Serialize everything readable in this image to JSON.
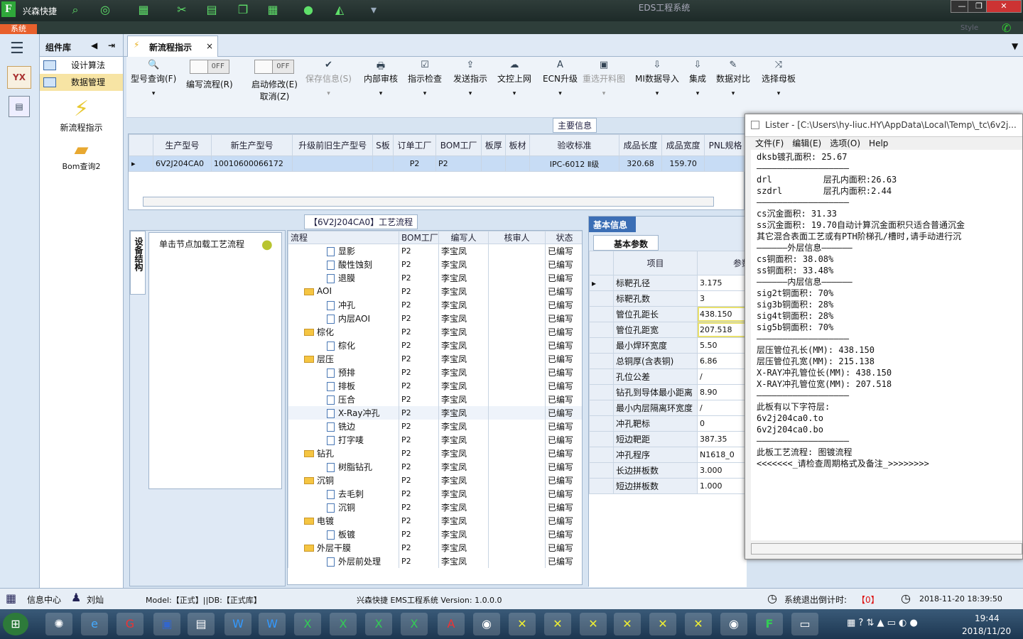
{
  "app": {
    "name": "兴森快捷",
    "window_title": "EDS工程系统",
    "menu_system": "系统",
    "style_label": "Style"
  },
  "rail": {
    "logo": "YX"
  },
  "left_panel": {
    "header": "组件库",
    "items": [
      {
        "label": "设计算法"
      },
      {
        "label": "数据管理"
      }
    ],
    "big_items": [
      {
        "label": "新流程指示"
      },
      {
        "label": "Bom查询2"
      }
    ]
  },
  "tab": {
    "label": "新流程指示"
  },
  "toolbar": {
    "buttons": [
      {
        "label": "型号查询(F)",
        "icon": "🔍"
      },
      {
        "label": "编写流程(R)",
        "toggle": "OFF"
      },
      {
        "label": "启动修改(E)",
        "label2": "取消(Z)",
        "toggle": "OFF"
      },
      {
        "label": "保存信息(S)",
        "icon": "✔"
      },
      {
        "label": "内部审核",
        "icon": "🖶"
      },
      {
        "label": "指示检查",
        "icon": "☑"
      },
      {
        "label": "发送指示",
        "icon": "⇪"
      },
      {
        "label": "文控上网",
        "icon": "☁"
      },
      {
        "label": "ECN升级",
        "icon": "A"
      },
      {
        "label": "重选开料图",
        "icon": "▣"
      },
      {
        "label": "MI数据导入",
        "icon": "⇩"
      },
      {
        "label": "集成",
        "icon": "⇩"
      },
      {
        "label": "数据对比",
        "icon": "✎"
      },
      {
        "label": "选择母板",
        "icon": "⤨"
      }
    ]
  },
  "main_info": {
    "title": "主要信息",
    "columns": [
      "生产型号",
      "新生产型号",
      "升级前旧生产型号",
      "S板",
      "订单工厂",
      "BOM工厂",
      "板厚",
      "板材",
      "验收标准",
      "成品长度",
      "成品宽度",
      "PNL规格"
    ],
    "row": [
      "6V2J204CA0",
      "10010600066172",
      "",
      "",
      "P2",
      "P2",
      "",
      "",
      "IPC-6012 Ⅱ级",
      "320.68",
      "159.70",
      ""
    ]
  },
  "process": {
    "title": "【6V2J204CA0】工艺流程",
    "side_tab": "设备结构",
    "node_hint": "单击节点加载工艺流程",
    "columns": [
      "流程",
      "BOM工厂",
      "编写人",
      "核审人",
      "状态"
    ],
    "rows": [
      {
        "name": "显影",
        "level": 2,
        "folder": false,
        "bom": "P2",
        "writer": "李宝凤",
        "status": "已编写"
      },
      {
        "name": "酸性蚀刻",
        "level": 2,
        "folder": false,
        "bom": "P2",
        "writer": "李宝凤",
        "status": "已编写"
      },
      {
        "name": "退膜",
        "level": 2,
        "folder": false,
        "bom": "P2",
        "writer": "李宝凤",
        "status": "已编写"
      },
      {
        "name": "AOI",
        "level": 1,
        "folder": true,
        "bom": "P2",
        "writer": "李宝凤",
        "status": "已编写"
      },
      {
        "name": "冲孔",
        "level": 2,
        "folder": false,
        "bom": "P2",
        "writer": "李宝凤",
        "status": "已编写"
      },
      {
        "name": "内层AOI",
        "level": 2,
        "folder": false,
        "bom": "P2",
        "writer": "李宝凤",
        "status": "已编写"
      },
      {
        "name": "棕化",
        "level": 1,
        "folder": true,
        "bom": "P2",
        "writer": "李宝凤",
        "status": "已编写"
      },
      {
        "name": "棕化",
        "level": 2,
        "folder": false,
        "bom": "P2",
        "writer": "李宝凤",
        "status": "已编写"
      },
      {
        "name": "层压",
        "level": 1,
        "folder": true,
        "bom": "P2",
        "writer": "李宝凤",
        "status": "已编写"
      },
      {
        "name": "预排",
        "level": 2,
        "folder": false,
        "bom": "P2",
        "writer": "李宝凤",
        "status": "已编写"
      },
      {
        "name": "排板",
        "level": 2,
        "folder": false,
        "bom": "P2",
        "writer": "李宝凤",
        "status": "已编写"
      },
      {
        "name": "压合",
        "level": 2,
        "folder": false,
        "bom": "P2",
        "writer": "李宝凤",
        "status": "已编写"
      },
      {
        "name": "X-Ray冲孔",
        "level": 2,
        "folder": false,
        "bom": "P2",
        "writer": "李宝凤",
        "status": "已编写"
      },
      {
        "name": "铣边",
        "level": 2,
        "folder": false,
        "bom": "P2",
        "writer": "李宝凤",
        "status": "已编写"
      },
      {
        "name": "打字唛",
        "level": 2,
        "folder": false,
        "bom": "P2",
        "writer": "李宝凤",
        "status": "已编写"
      },
      {
        "name": "钻孔",
        "level": 1,
        "folder": true,
        "bom": "P2",
        "writer": "李宝凤",
        "status": "已编写"
      },
      {
        "name": "树脂钻孔",
        "level": 2,
        "folder": false,
        "bom": "P2",
        "writer": "李宝凤",
        "status": "已编写"
      },
      {
        "name": "沉铜",
        "level": 1,
        "folder": true,
        "bom": "P2",
        "writer": "李宝凤",
        "status": "已编写"
      },
      {
        "name": "去毛刺",
        "level": 2,
        "folder": false,
        "bom": "P2",
        "writer": "李宝凤",
        "status": "已编写"
      },
      {
        "name": "沉铜",
        "level": 2,
        "folder": false,
        "bom": "P2",
        "writer": "李宝凤",
        "status": "已编写"
      },
      {
        "name": "电镀",
        "level": 1,
        "folder": true,
        "bom": "P2",
        "writer": "李宝凤",
        "status": "已编写"
      },
      {
        "name": "板镀",
        "level": 2,
        "folder": false,
        "bom": "P2",
        "writer": "李宝凤",
        "status": "已编写"
      },
      {
        "name": "外层干膜",
        "level": 1,
        "folder": true,
        "bom": "P2",
        "writer": "李宝凤",
        "status": "已编写"
      },
      {
        "name": "外层前处理",
        "level": 2,
        "folder": false,
        "bom": "P2",
        "writer": "李宝凤",
        "status": "已编写"
      }
    ]
  },
  "basic": {
    "tab": "基本信息",
    "subtab": "基本参数",
    "col_item": "项目",
    "col_param": "参数",
    "rows": [
      {
        "item": "标靶孔径",
        "value": "3.175"
      },
      {
        "item": "标靶孔数",
        "value": "3"
      },
      {
        "item": "管位孔距长",
        "value": "438.150",
        "hl": true
      },
      {
        "item": "管位孔距宽",
        "value": "207.518",
        "hl": true
      },
      {
        "item": "最小焊环宽度",
        "value": "5.50"
      },
      {
        "item": "总铜厚(含表铜)",
        "value": "6.86"
      },
      {
        "item": "孔位公差",
        "value": "/"
      },
      {
        "item": "钻孔到导体最小距离",
        "value": "8.90"
      },
      {
        "item": "最小内层隔离环宽度",
        "value": "/"
      },
      {
        "item": "冲孔靶标",
        "value": "0"
      },
      {
        "item": "短边靶距",
        "value": "387.35"
      },
      {
        "item": "冲孔程序",
        "value": "N1618_0"
      },
      {
        "item": "长边拼板数",
        "value": "3.000"
      },
      {
        "item": "短边拼板数",
        "value": "1.000"
      }
    ]
  },
  "lister": {
    "title": "Lister - [C:\\Users\\hy-liuc.HY\\AppData\\Local\\Temp\\_tc\\6v2j...",
    "menu": [
      "文件(F)",
      "编辑(E)",
      "选项(O)",
      "Help"
    ],
    "lines": [
      "dksb镀孔面积: 25.67",
      "",
      "——————————————————",
      "drl          层孔内面积:26.63",
      "szdrl        层孔内面积:2.44",
      "",
      "——————————————————",
      "cs沉金面积: 31.33",
      "ss沉金面积: 19.70自动计算沉金面积只适合普通沉金",
      "其它混合表面工艺或有PTH阶梯孔/槽时,请手动进行沉",
      "——————外层信息——————",
      "cs铜面积: 38.08%",
      "ss铜面积: 33.48%",
      "——————内层信息——————",
      "sig2t铜面积: 70%",
      "sig3b铜面积: 28%",
      "sig4t铜面积: 28%",
      "sig5b铜面积: 70%",
      "——————————————————",
      "层压管位孔长(MM): 438.150",
      "层压管位孔宽(MM): 215.138",
      "",
      "X-RAY冲孔管位长(MM): 438.150",
      "X-RAY冲孔管位宽(MM): 207.518",
      "",
      "——————————————————",
      "此板有以下字符层:",
      "6v2j204ca0.to",
      "6v2j204ca0.bo",
      "——————————————————",
      "此板工艺流程: 图镀流程",
      "<<<<<<<_请检查周期格式及备注_>>>>>>>>"
    ]
  },
  "status": {
    "info_center": "信息中心",
    "user": "刘灿",
    "model": "Model:【正式】||DB:【正式库】",
    "version": "兴森快捷 EMS工程系统 Version: 1.0.0.0",
    "logout": "系统退出倒计时:",
    "countdown": "【0】",
    "datetime": "2018-11-20 18:39:50"
  },
  "taskbar": {
    "time": "19:44",
    "date": "2018/11/20"
  }
}
